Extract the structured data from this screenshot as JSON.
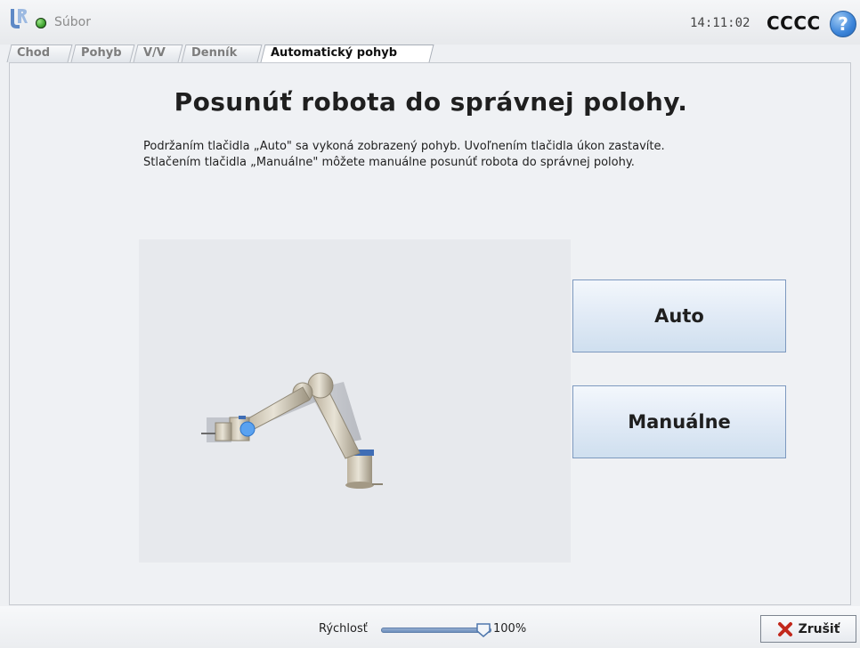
{
  "topbar": {
    "file_menu": "Súbor",
    "clock": "14:11:02",
    "robot_name": "CCCC",
    "help_symbol": "?",
    "logo_icon": "ur-logo-icon",
    "status_icon": "status-led-green"
  },
  "tabs": [
    {
      "label": "Chod",
      "active": false
    },
    {
      "label": "Pohyb",
      "active": false
    },
    {
      "label": "V/V",
      "active": false
    },
    {
      "label": "Denník",
      "active": false
    },
    {
      "label": "Automatický pohyb",
      "active": true
    }
  ],
  "main": {
    "heading": "Posunúť robota do správnej polohy.",
    "instruction_line1": "Podržaním tlačidla „Auto\" sa vykoná zobrazený pohyb. Uvoľnením tlačidla úkon zastavíte.",
    "instruction_line2": "Stlačením tlačidla „Manuálne\" môžete manuálne posunúť robota do správnej polohy.",
    "auto_button": "Auto",
    "manual_button": "Manuálne"
  },
  "bottombar": {
    "speed_label": "Rýchlosť",
    "speed_value": "100%",
    "speed_fraction": 1.0,
    "cancel_label": "Zrušiť",
    "cancel_icon": "x-icon"
  },
  "colors": {
    "accent": "#3b84d9",
    "button_border": "#7d99bf",
    "cancel_x": "#c2281c",
    "status_led": "#3ea12f"
  }
}
